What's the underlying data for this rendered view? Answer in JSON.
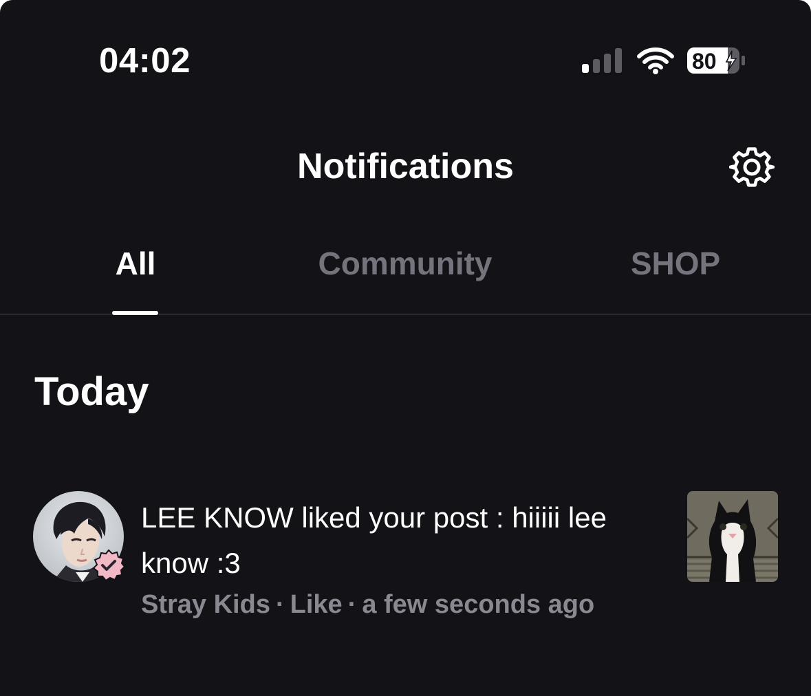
{
  "status_bar": {
    "time": "04:02",
    "battery_level": "80",
    "signal_icon": "cellular-signal-icon",
    "wifi_icon": "wifi-icon",
    "battery_icon": "battery-charging-icon"
  },
  "header": {
    "title": "Notifications",
    "settings_icon": "gear-icon"
  },
  "tabs": [
    {
      "label": "All",
      "active": true
    },
    {
      "label": "Community",
      "active": false
    },
    {
      "label": "SHOP",
      "active": false
    }
  ],
  "sections": [
    {
      "title": "Today",
      "items": [
        {
          "text": "LEE KNOW liked your post : hiiiii lee know :3",
          "meta": {
            "source": "Stray Kids",
            "type": "Like",
            "time": "a few seconds ago",
            "separator": "·"
          },
          "avatar_icon": "artist-avatar",
          "badge_icon": "verified-badge-icon",
          "thumbnail_icon": "cat-photo-thumbnail"
        }
      ]
    }
  ],
  "colors": {
    "background": "#131217",
    "text_primary": "#ffffff",
    "text_inactive_tab": "#75737c",
    "text_meta": "#8a8891",
    "badge_pink": "#f2b8c6",
    "divider": "#2a292f"
  }
}
